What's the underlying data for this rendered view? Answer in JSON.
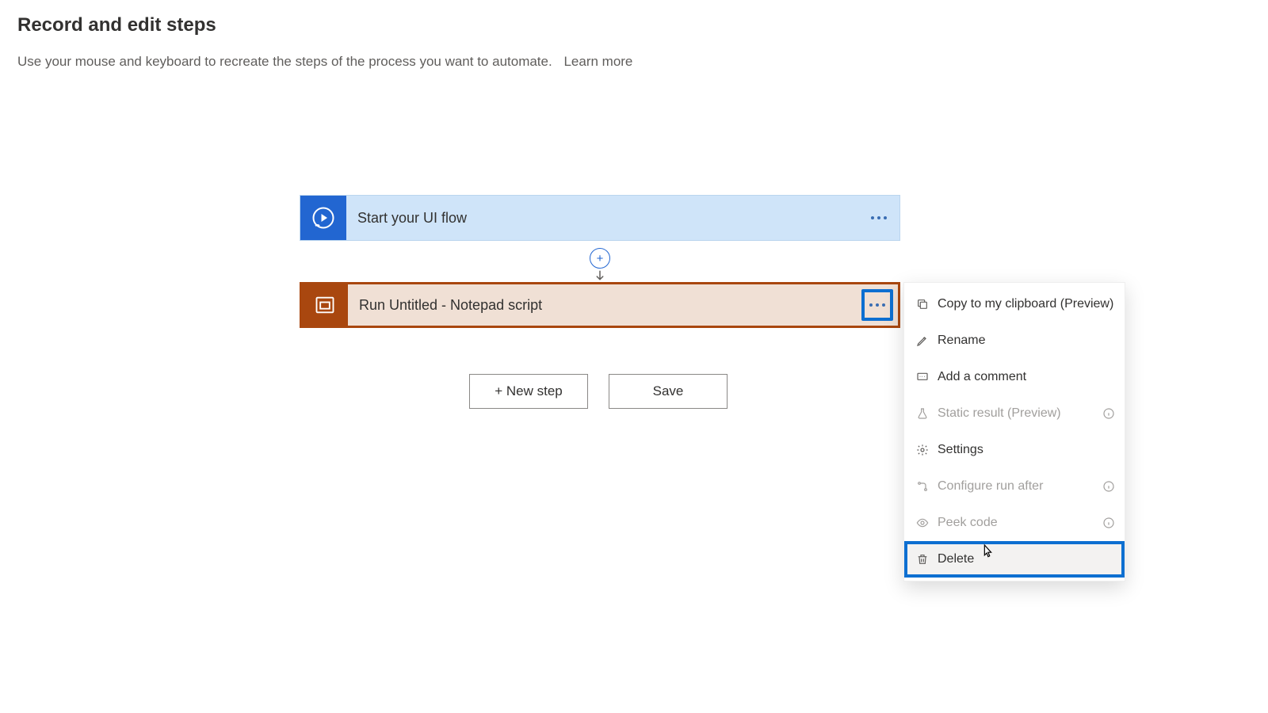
{
  "header": {
    "title": "Record and edit steps",
    "subtitle": "Use your mouse and keyboard to recreate the steps of the process you want to automate.",
    "learn_more": "Learn more"
  },
  "cards": {
    "start": {
      "title": "Start your UI flow"
    },
    "run": {
      "title": "Run Untitled - Notepad script"
    }
  },
  "buttons": {
    "new_step": "+ New step",
    "save": "Save"
  },
  "menu": {
    "copy": "Copy to my clipboard (Preview)",
    "rename": "Rename",
    "comment": "Add a comment",
    "static": "Static result (Preview)",
    "settings": "Settings",
    "run_after": "Configure run after",
    "peek": "Peek code",
    "delete": "Delete"
  }
}
